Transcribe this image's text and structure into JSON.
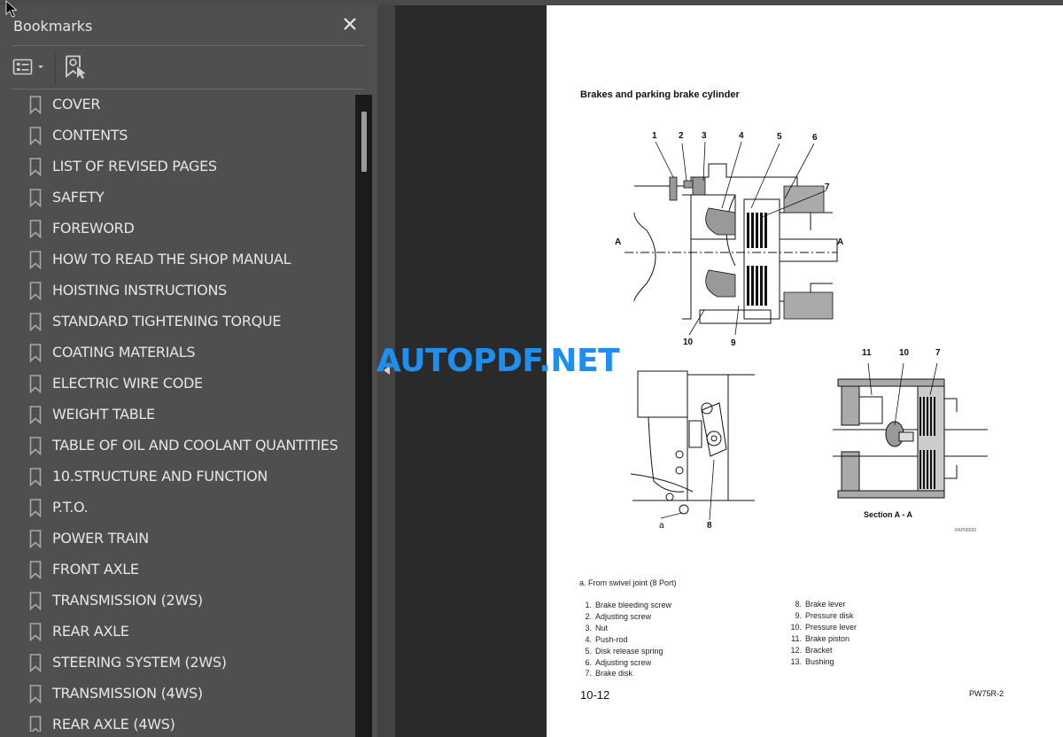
{
  "bookmarks_panel": {
    "title": "Bookmarks",
    "close_icon": "close-icon",
    "options_icon": "list-options-icon",
    "find_bookmark_icon": "find-current-bookmark-icon",
    "items": [
      {
        "label": "COVER"
      },
      {
        "label": "CONTENTS"
      },
      {
        "label": "LIST OF REVISED PAGES"
      },
      {
        "label": "SAFETY"
      },
      {
        "label": "FOREWORD"
      },
      {
        "label": "HOW TO READ THE SHOP MANUAL"
      },
      {
        "label": "HOISTING INSTRUCTIONS"
      },
      {
        "label": "STANDARD TIGHTENING TORQUE"
      },
      {
        "label": "COATING MATERIALS"
      },
      {
        "label": "ELECTRIC WIRE CODE"
      },
      {
        "label": "WEIGHT TABLE"
      },
      {
        "label": "TABLE OF OIL AND COOLANT QUANTITIES"
      },
      {
        "label": "10.STRUCTURE AND FUNCTION"
      },
      {
        "label": "P.T.O."
      },
      {
        "label": "POWER TRAIN"
      },
      {
        "label": "FRONT AXLE"
      },
      {
        "label": "TRANSMISSION (2WS)"
      },
      {
        "label": "REAR AXLE"
      },
      {
        "label": "STEERING SYSTEM (2WS)"
      },
      {
        "label": "TRANSMISSION (4WS)"
      },
      {
        "label": "REAR AXLE (4WS)"
      }
    ]
  },
  "watermark": "AUTOPDF.NET",
  "page": {
    "heading": "Brakes and parking brake cylinder",
    "callouts_top": [
      "1",
      "2",
      "3",
      "4",
      "5",
      "6",
      "7",
      "10",
      "9"
    ],
    "section_marker": "A",
    "callouts_bottom_left": [
      "a",
      "8"
    ],
    "callouts_bottom_right": [
      "11",
      "10",
      "7"
    ],
    "section_label": "Section A - A",
    "figure_id": "RKP08920",
    "note": "a. From swivel joint (8 Port)",
    "legend_left": [
      {
        "num": "1.",
        "text": "Brake bleeding screw"
      },
      {
        "num": "2.",
        "text": "Adjusting screw"
      },
      {
        "num": "3.",
        "text": "Nut"
      },
      {
        "num": "4.",
        "text": "Push-rod"
      },
      {
        "num": "5.",
        "text": "Disk release spring"
      },
      {
        "num": "6.",
        "text": "Adjusting screw"
      },
      {
        "num": "7.",
        "text": "Brake disk"
      }
    ],
    "legend_right": [
      {
        "num": "8.",
        "text": "Brake lever"
      },
      {
        "num": "9.",
        "text": "Pressure disk"
      },
      {
        "num": "10.",
        "text": "Pressure lever"
      },
      {
        "num": "11.",
        "text": "Brake piston"
      },
      {
        "num": "12.",
        "text": "Bracket"
      },
      {
        "num": "13.",
        "text": "Bushing"
      }
    ],
    "page_number": "10-12",
    "model": "PW75R-2"
  }
}
